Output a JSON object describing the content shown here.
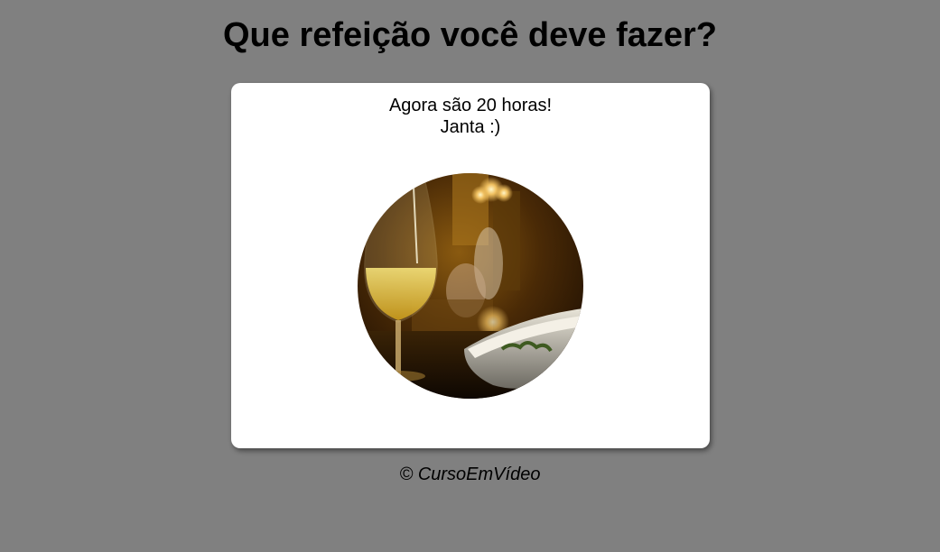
{
  "header": {
    "title": "Que refeição você deve fazer?"
  },
  "card": {
    "time_message": "Agora são 20 horas!",
    "meal_message": "Janta :)",
    "image_alt": "dinner-photo"
  },
  "footer": {
    "text": "© CursoEmVídeo"
  },
  "colors": {
    "background": "#808080",
    "card": "#ffffff",
    "text": "#000000"
  }
}
